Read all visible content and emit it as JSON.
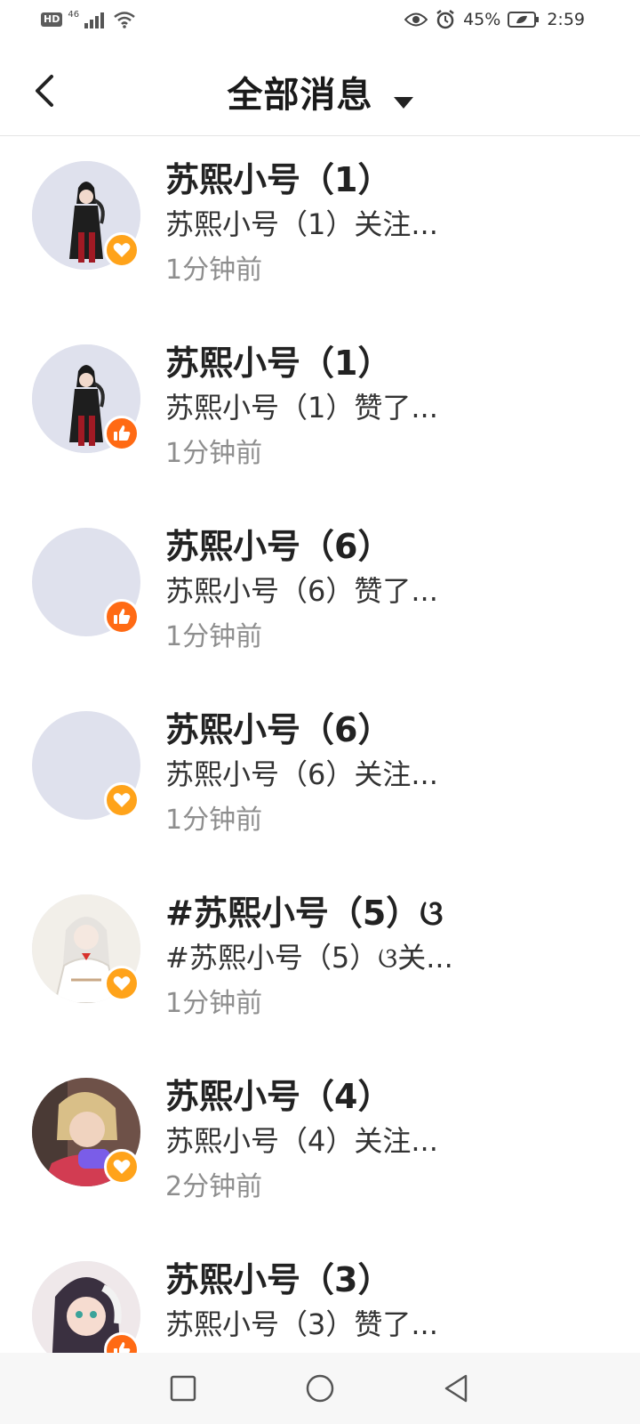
{
  "status_bar": {
    "hd": "HD",
    "network": "46",
    "battery_percent": "45%",
    "time": "2:59"
  },
  "header": {
    "title": "全部消息"
  },
  "messages": [
    {
      "name": "苏熙小号（1）",
      "message": "苏熙小号（1）关注...",
      "time": "1分钟前",
      "badge": "follow",
      "avatar": "gothic-character"
    },
    {
      "name": "苏熙小号（1）",
      "message": "苏熙小号（1）赞了...",
      "time": "1分钟前",
      "badge": "like",
      "avatar": "gothic-character"
    },
    {
      "name": "苏熙小号（6）",
      "message": "苏熙小号（6）赞了...",
      "time": "1分钟前",
      "badge": "like",
      "avatar": "blank"
    },
    {
      "name": "苏熙小号（6）",
      "message": "苏熙小号（6）关注...",
      "time": "1分钟前",
      "badge": "follow",
      "avatar": "blank"
    },
    {
      "name": "#苏熙小号（5）ଓ",
      "message": "#苏熙小号（5）ଓ关...",
      "time": "1分钟前",
      "badge": "follow",
      "avatar": "white-hair-character"
    },
    {
      "name": "苏熙小号（4）",
      "message": "苏熙小号（4）关注...",
      "time": "2分钟前",
      "badge": "follow",
      "avatar": "blond-gamer-character"
    },
    {
      "name": "苏熙小号（3）",
      "message": "苏熙小号（3）赞了...",
      "time": "",
      "badge": "like",
      "avatar": "anime-girl-character"
    }
  ]
}
